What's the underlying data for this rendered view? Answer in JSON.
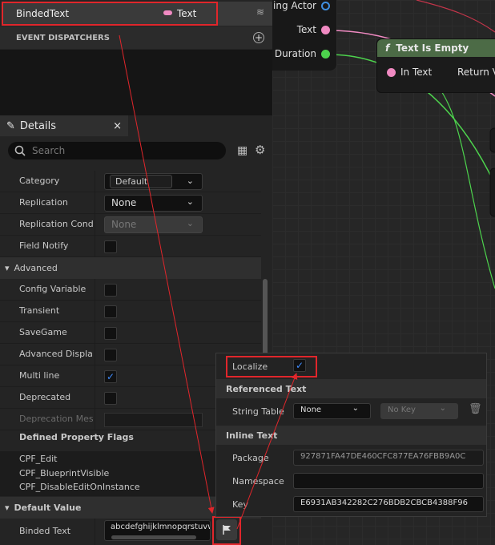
{
  "my_blueprint": {
    "variable_name": "BindedText",
    "variable_type": "Text",
    "event_dispatchers_label": "EVENT DISPATCHERS"
  },
  "graph": {
    "node_pins": [
      {
        "label": "ing Actor",
        "color": "#3f8fe0"
      },
      {
        "label": "Text",
        "color": "#f08ac2"
      },
      {
        "label": "Duration",
        "color": "#4dd34d"
      }
    ],
    "function_node": {
      "title": "Text Is Empty",
      "icon": "f",
      "input_label": "In Text",
      "output_label": "Return V"
    }
  },
  "details": {
    "tab_label": "Details",
    "search_placeholder": "Search",
    "rows": {
      "category": {
        "label": "Category",
        "value": "Default"
      },
      "replication": {
        "label": "Replication",
        "value": "None"
      },
      "replication_condition": {
        "label": "Replication Condit",
        "value": "None"
      },
      "field_notify": {
        "label": "Field Notify"
      },
      "advanced_section": "Advanced",
      "config_variable": {
        "label": "Config Variable"
      },
      "transient": {
        "label": "Transient"
      },
      "savegame": {
        "label": "SaveGame"
      },
      "advanced_display": {
        "label": "Advanced Display"
      },
      "multi_line": {
        "label": "Multi line",
        "checked": true
      },
      "deprecated": {
        "label": "Deprecated"
      },
      "deprecation_message": {
        "label": "Deprecation Mess"
      },
      "defined_flags_heading": "Defined Property Flags",
      "flags": [
        "CPF_Edit",
        "CPF_BlueprintVisible",
        "CPF_DisableEditOnInstance"
      ],
      "default_value_section": "Default Value",
      "binded_text": {
        "label": "Binded Text",
        "value": "abcdefghijklmnopqrstuvw"
      }
    }
  },
  "localize_popup": {
    "localize_label": "Localize",
    "localize_checked": true,
    "referenced_text_heading": "Referenced Text",
    "string_table_label": "String Table",
    "string_table_value": "None",
    "no_key_value": "No Key",
    "inline_text_heading": "Inline Text",
    "package_label": "Package",
    "package_value": "927871FA47DE460CFC877EA76FBB9A0C",
    "namespace_label": "Namespace",
    "namespace_value": "",
    "key_label": "Key",
    "key_value": "E6931AB342282C276BDB2CBCB4388F96"
  },
  "colors": {
    "annotation_red": "#e0262b",
    "checkbox_blue": "#3f8cff",
    "function_header_green": "#4c6b46",
    "text_pin_pink": "#f08ac2"
  }
}
